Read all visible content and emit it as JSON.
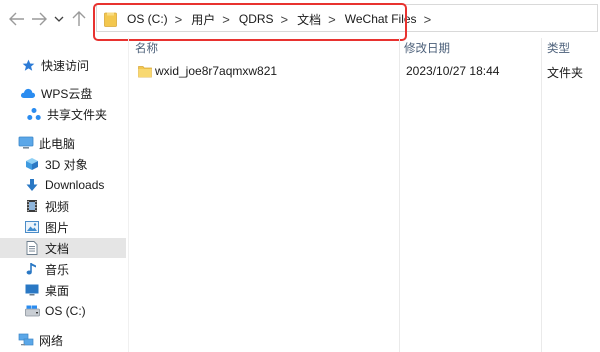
{
  "breadcrumb": {
    "items": [
      "OS (C:)",
      "用户",
      "QDRS",
      "文档",
      "WeChat Files"
    ],
    "separator": ">"
  },
  "nav": {
    "back_icon": "arrow-left-icon",
    "forward_icon": "arrow-right-icon",
    "recent_icon": "chevron-down-icon",
    "up_icon": "arrow-up-icon"
  },
  "sidebar": {
    "items": [
      {
        "label": "快速访问",
        "icon": "star-icon"
      },
      {
        "label": "WPS云盘",
        "icon": "cloud-icon"
      },
      {
        "label": "共享文件夹",
        "icon": "share-icon"
      },
      {
        "label": "此电脑",
        "icon": "computer-icon"
      },
      {
        "label": "3D 对象",
        "icon": "cube-icon"
      },
      {
        "label": "Downloads",
        "icon": "download-icon"
      },
      {
        "label": "视频",
        "icon": "video-icon"
      },
      {
        "label": "图片",
        "icon": "image-icon"
      },
      {
        "label": "文档",
        "icon": "document-icon"
      },
      {
        "label": "音乐",
        "icon": "music-icon"
      },
      {
        "label": "桌面",
        "icon": "desktop-icon"
      },
      {
        "label": "OS (C:)",
        "icon": "drive-icon"
      },
      {
        "label": "网络",
        "icon": "network-icon"
      }
    ]
  },
  "columns": {
    "name": "名称",
    "modified": "修改日期",
    "type": "类型"
  },
  "files": [
    {
      "name": "wxid_joe8r7aqmxw821",
      "modified": "2023/10/27 18:44",
      "type": "文件夹"
    }
  ],
  "colors": {
    "highlight_border": "#e8322f",
    "selected_bg": "#e5e5e5",
    "folder": "#f3c74e",
    "header_text": "#4c607a"
  }
}
